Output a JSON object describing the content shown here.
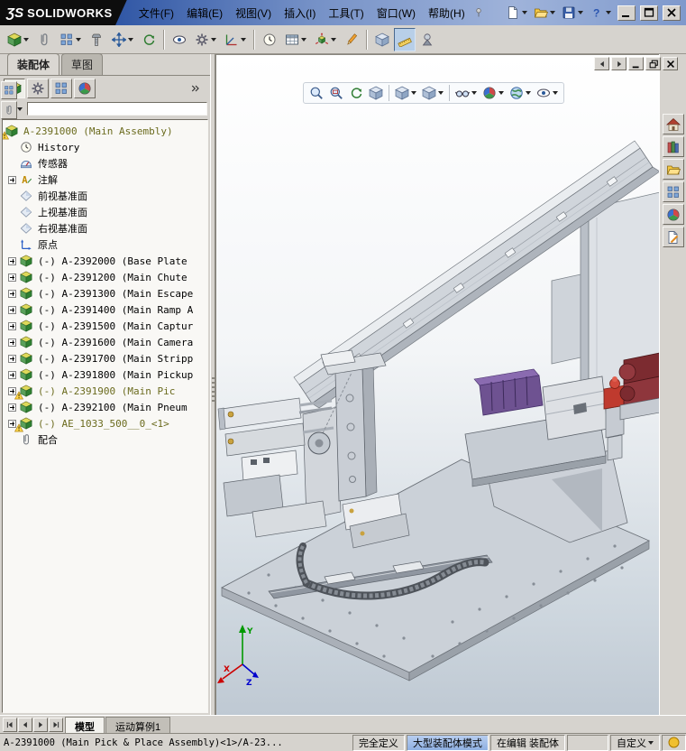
{
  "titlebar": {
    "logo": {
      "mark": "ƷS",
      "brand": "SOLIDWORKS"
    },
    "menus": [
      "文件(F)",
      "编辑(E)",
      "视图(V)",
      "插入(I)",
      "工具(T)",
      "窗口(W)",
      "帮助(H)"
    ]
  },
  "command_tabs": {
    "assembly": "装配体",
    "sketch": "草图"
  },
  "feature_tree": {
    "root": "A-2391000 (Main Assembly)",
    "items": [
      {
        "label": "History"
      },
      {
        "label": "传感器"
      },
      {
        "label": "注解"
      },
      {
        "label": "前视基准面"
      },
      {
        "label": "上视基准面"
      },
      {
        "label": "右视基准面"
      },
      {
        "label": "原点"
      },
      {
        "label": "(-) A-2392000 (Base Plate"
      },
      {
        "label": "(-) A-2391200 (Main Chute"
      },
      {
        "label": "(-) A-2391300 (Main Escape"
      },
      {
        "label": "(-) A-2391400 (Main Ramp A"
      },
      {
        "label": "(-) A-2391500 (Main Captur"
      },
      {
        "label": "(-) A-2391600 (Main Camera"
      },
      {
        "label": "(-) A-2391700 (Main Stripp"
      },
      {
        "label": "(-) A-2391800 (Main Pickup"
      },
      {
        "label": "(-) A-2391900 (Main Pic"
      },
      {
        "label": "(-) A-2392100 (Main Pneum"
      },
      {
        "label": "(-) AE_1033_500__0_<1>"
      },
      {
        "label": "配合"
      }
    ]
  },
  "filter": {
    "value": ""
  },
  "triad": {
    "x": "X",
    "y": "Y",
    "z": "Z"
  },
  "bottom_tabs": {
    "model": "模型",
    "motion_study": "运动算例1"
  },
  "statusbar": {
    "selection": "A-2391000 (Main Pick & Place Assembly)<1>/A-23...",
    "define_state": "完全定义",
    "assembly_mode": "大型装配体模式",
    "edit_state": "在编辑 装配体",
    "custom": "自定义"
  },
  "colors": {
    "titlebar_blue": "#2e55a4",
    "warning_yellow": "#ffd84d",
    "status_mode_blue": "#8fb0e2",
    "warn_text_olive": "#6b6b1e",
    "purple_part": "#6e5291",
    "red_part": "#bf3a2e",
    "maroon_motor": "#7c2b30"
  }
}
